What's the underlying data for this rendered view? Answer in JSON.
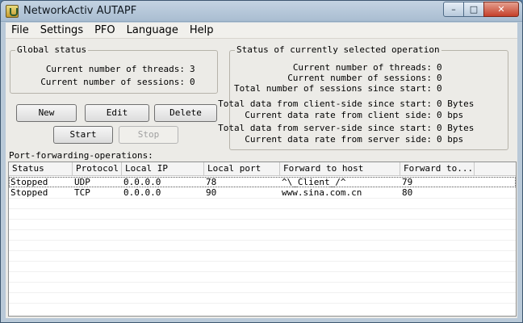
{
  "window": {
    "title": "NetworkActiv AUTAPF"
  },
  "menu": [
    "File",
    "Settings",
    "PFO",
    "Language",
    "Help"
  ],
  "global_status": {
    "title": "Global status",
    "threads_label": "Current number of threads:",
    "threads_value": "3",
    "sessions_label": "Current number of sessions:",
    "sessions_value": "0"
  },
  "buttons": {
    "new": "New",
    "edit": "Edit",
    "delete": "Delete",
    "start": "Start",
    "stop": "Stop"
  },
  "selected_status": {
    "title": "Status of currently selected operation",
    "rows": [
      {
        "label": "Current number of threads:",
        "value": "0"
      },
      {
        "label": "Current number of sessions:",
        "value": "0"
      },
      {
        "label": "Total number of sessions since start:",
        "value": "0"
      },
      {
        "label": "Total data from client-side since start:",
        "value": "0 Bytes"
      },
      {
        "label": "Current data rate from client side:",
        "value": "0 bps"
      },
      {
        "label": "Total data from server-side since start:",
        "value": "0 Bytes"
      },
      {
        "label": "Current data rate from server side:",
        "value": "0 bps"
      }
    ]
  },
  "operations": {
    "label": "Port-forwarding-operations:",
    "columns": [
      "Status",
      "Protocol",
      "Local IP",
      "Local port",
      "Forward to host",
      "Forward to..."
    ],
    "rows": [
      [
        "Stopped",
        "UDP",
        "0.0.0.0",
        "78",
        "^\\_Client_/^",
        "79"
      ],
      [
        "Stopped",
        "TCP",
        "0.0.0.0",
        "90",
        "www.sina.com.cn",
        "80"
      ]
    ]
  }
}
